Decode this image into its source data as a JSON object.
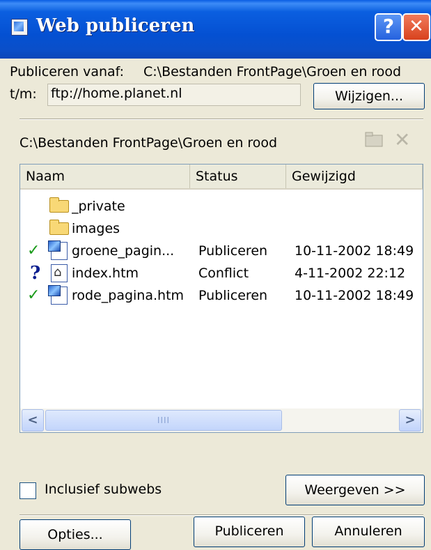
{
  "window": {
    "title": "Web publiceren",
    "help_glyph": "?",
    "close_glyph": "✕",
    "title_icon": "web-publish-icon"
  },
  "publish": {
    "from_label": "Publiceren vanaf:",
    "from_value": "C:\\Bestanden FrontPage\\Groen en rood",
    "to_label": "t/m:",
    "to_value": "ftp://home.planet.nl",
    "change_button": "Wijzigen..."
  },
  "local": {
    "path": "C:\\Bestanden FrontPage\\Groen en rood",
    "folder_icon": "new-folder-icon",
    "delete_icon": "delete-icon",
    "delete_glyph": "✕"
  },
  "list": {
    "columns": [
      "Naam",
      "Status",
      "Gewijzigd"
    ],
    "rows": [
      {
        "mark": "",
        "icon": "folder-icon",
        "name": "_private",
        "status": "",
        "modified": ""
      },
      {
        "mark": "",
        "icon": "folder-icon",
        "name": "images",
        "status": "",
        "modified": ""
      },
      {
        "mark": "✓",
        "icon": "web-page-icon",
        "name": "groene_pagin...",
        "status": "Publiceren",
        "modified": "10-11-2002 18:49"
      },
      {
        "mark": "?",
        "icon": "home-page-icon",
        "name": "index.htm",
        "status": "Conflict",
        "modified": "4-11-2002 22:12"
      },
      {
        "mark": "✓",
        "icon": "web-page-icon",
        "name": "rode_pagina.htm",
        "status": "Publiceren",
        "modified": "10-11-2002 18:49"
      }
    ],
    "scroll_left": "<",
    "scroll_right": ">",
    "scroll_grip": "IIII"
  },
  "options": {
    "include_subwebs_label": "Inclusief subwebs",
    "include_subwebs_checked": false,
    "show_button": "Weergeven >>"
  },
  "footer": {
    "options_button": "Opties...",
    "publish_button": "Publiceren",
    "cancel_button": "Annuleren"
  },
  "colors": {
    "titlebar": "#0450d2",
    "dialog_bg": "#ece9d8",
    "check_green": "#1a9a1a",
    "question_blue": "#0b1e8f"
  }
}
